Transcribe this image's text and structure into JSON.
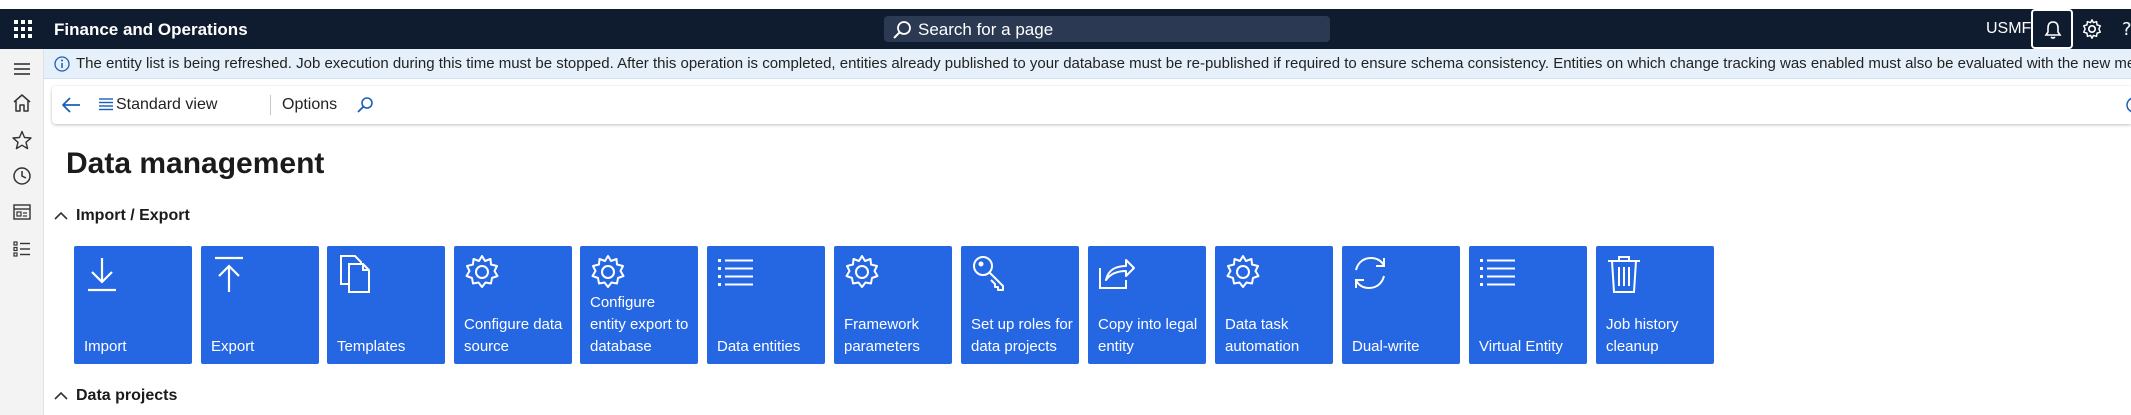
{
  "topbar": {
    "app_title": "Finance and Operations",
    "search_placeholder": "Search for a page",
    "company": "USMF"
  },
  "infobar": {
    "message": "The entity list is being refreshed. Job execution during this time must be stopped. After this operation is completed, entities already published to your database must be re-published if required to ensure schema consistency. Entities on which change tracking was enabled must also be evaluated with the new metadata changes and if needed"
  },
  "actionbar": {
    "view_label": "Standard view",
    "options_label": "Options"
  },
  "page": {
    "title": "Data management"
  },
  "sections": {
    "import_export": "Import / Export",
    "data_projects": "Data projects"
  },
  "tiles": [
    {
      "label": "Import",
      "icon": "download-icon"
    },
    {
      "label": "Export",
      "icon": "upload-icon"
    },
    {
      "label": "Templates",
      "icon": "documents-icon"
    },
    {
      "label": "Configure data source",
      "icon": "gear-icon"
    },
    {
      "label": "Configure entity export to database",
      "icon": "gear-icon"
    },
    {
      "label": "Data entities",
      "icon": "list-icon"
    },
    {
      "label": "Framework parameters",
      "icon": "gear-icon"
    },
    {
      "label": "Set up roles for data projects",
      "icon": "key-icon"
    },
    {
      "label": "Copy into legal entity",
      "icon": "share-icon"
    },
    {
      "label": "Data task automation",
      "icon": "gear-icon"
    },
    {
      "label": "Dual-write",
      "icon": "sync-icon"
    },
    {
      "label": "Virtual Entity",
      "icon": "list-icon"
    },
    {
      "label": "Job history cleanup",
      "icon": "trash-icon"
    }
  ],
  "colors": {
    "topbar": "#0f1b2e",
    "tile": "#2566e3",
    "infobar": "#e6f0fa",
    "accent": "#2566e3"
  }
}
